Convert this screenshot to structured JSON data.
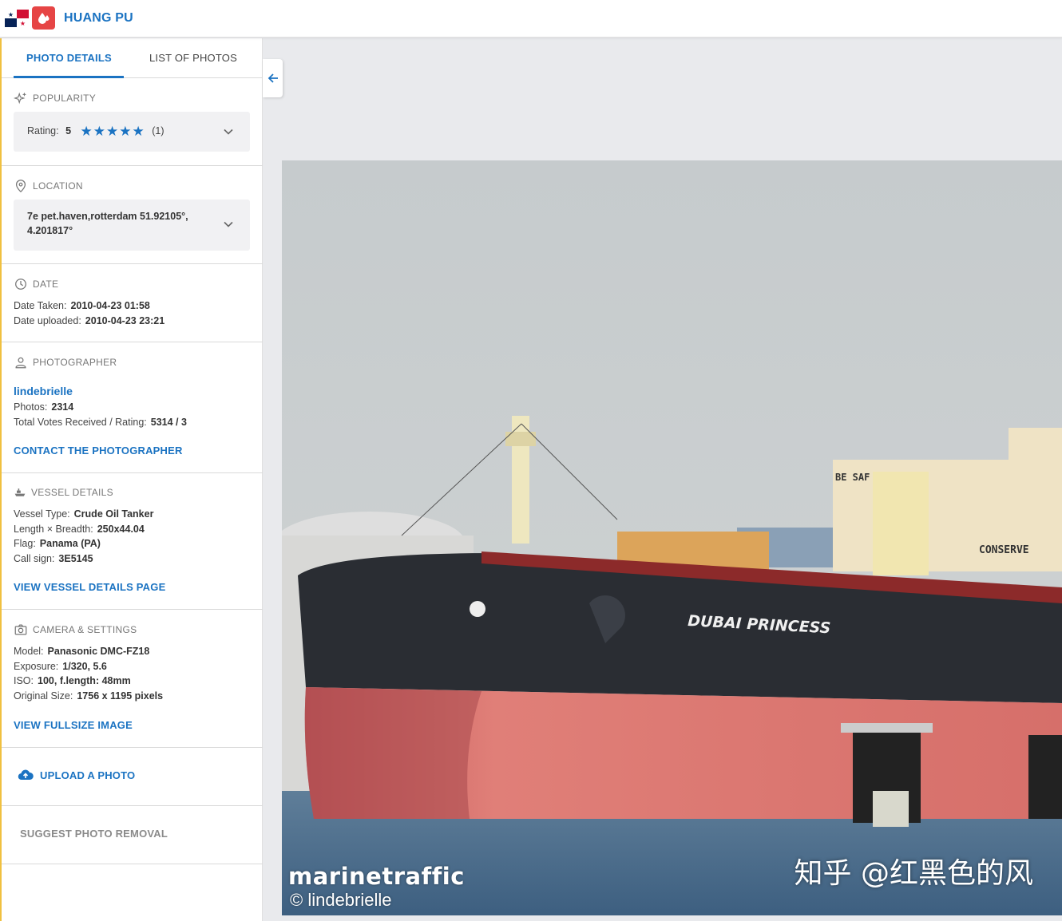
{
  "header": {
    "vessel_name": "HUANG PU",
    "flag_icon": "panama-flag-icon",
    "type_icon": "tanker-drop-icon",
    "colors": {
      "accent": "#1b73c2",
      "vessel_type": "#e64545"
    }
  },
  "tabs": [
    {
      "label": "PHOTO DETAILS",
      "active": true
    },
    {
      "label": "LIST OF PHOTOS",
      "active": false
    }
  ],
  "popularity": {
    "title": "POPULARITY",
    "rating_label": "Rating:",
    "rating_value": "5",
    "stars": 5,
    "votes": "(1)"
  },
  "location": {
    "title": "LOCATION",
    "line1": "7e pet.haven,rotterdam 51.92105°,",
    "line2": "4.201817°"
  },
  "date": {
    "title": "DATE",
    "taken_label": "Date Taken:",
    "taken_value": "2010-04-23 01:58",
    "uploaded_label": "Date uploaded:",
    "uploaded_value": "2010-04-23 23:21"
  },
  "photographer": {
    "title": "PHOTOGRAPHER",
    "name": "lindebrielle",
    "photos_label": "Photos:",
    "photos_value": "2314",
    "votes_label": "Total Votes Received / Rating:",
    "votes_value": "5314 / 3",
    "contact_link": "CONTACT THE PHOTOGRAPHER"
  },
  "vessel": {
    "title": "VESSEL DETAILS",
    "type_label": "Vessel Type:",
    "type_value": "Crude Oil Tanker",
    "size_label": "Length × Breadth:",
    "size_value": "250x44.04",
    "flag_label": "Flag:",
    "flag_value": "Panama (PA)",
    "call_label": "Call sign:",
    "call_value": "3E5145",
    "link": "VIEW VESSEL DETAILS PAGE"
  },
  "camera": {
    "title": "CAMERA & SETTINGS",
    "model_label": "Model:",
    "model_value": "Panasonic DMC-FZ18",
    "exposure_label": "Exposure:",
    "exposure_value": "1/320, 5.6",
    "iso_label": "ISO:",
    "iso_value": "100, f.length: 48mm",
    "size_label": "Original Size:",
    "size_value": "1756 x 1195 pixels",
    "link": "VIEW FULLSIZE IMAGE"
  },
  "actions": {
    "upload": "UPLOAD A PHOTO",
    "suggest_removal": "SUGGEST PHOTO REMOVAL"
  },
  "photo": {
    "hull_name": "DUBAI PRINCESS",
    "bridge_text_1": "BE SAF",
    "bridge_text_2": "CONSERVE",
    "watermark_brand": "marinetraffic",
    "watermark_copyright": "© lindebrielle",
    "watermark_overlay": "知乎 @红黑色的风"
  }
}
